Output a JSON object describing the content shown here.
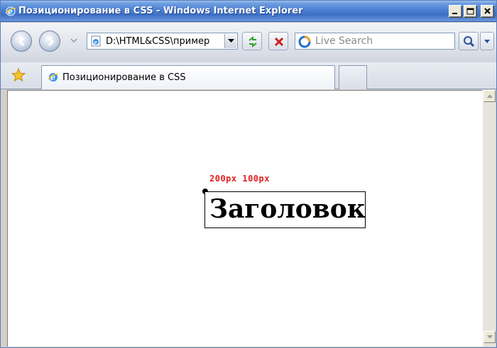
{
  "window": {
    "title": "Позиционирование в CSS - Windows Internet Explorer",
    "title_icon": "ie-icon",
    "controls": [
      "minimize-icon",
      "maximize-icon",
      "close-icon"
    ]
  },
  "navbar": {
    "back_icon": "back-arrow-icon",
    "forward_icon": "forward-arrow-icon",
    "address": "D:\\HTML&CSS\\пример",
    "refresh_icon": "refresh-icon",
    "stop_icon": "stop-icon",
    "search_placeholder": "Live Search",
    "search_logo": "live-search-logo",
    "search_go_icon": "search-icon"
  },
  "tabbar": {
    "favorites_icon": "favorites-star-icon",
    "tab_label": "Позиционирование в CSS"
  },
  "content": {
    "coords_label": "200px  100px",
    "heading": "Заголовок"
  },
  "colors": {
    "coords": "#e02020",
    "titlebar": "#4b7fd2"
  }
}
